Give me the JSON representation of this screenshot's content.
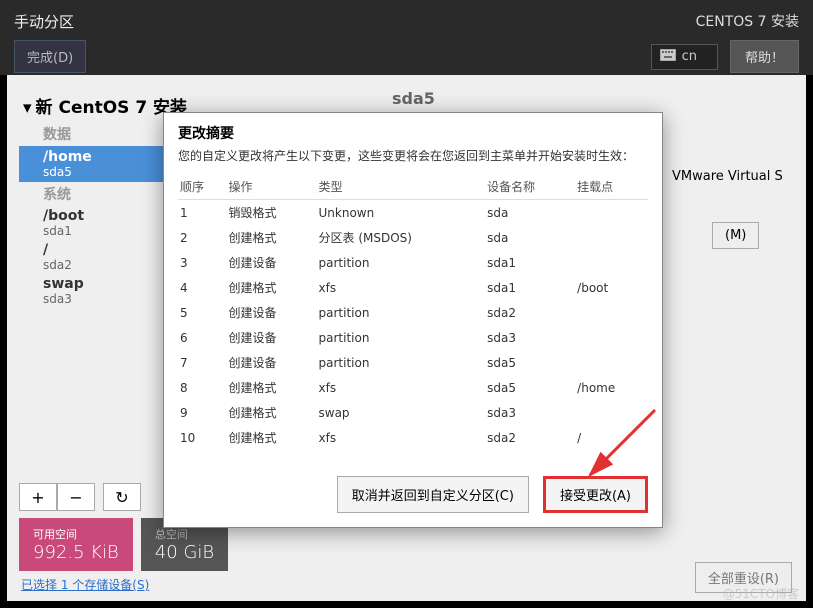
{
  "header": {
    "title": "手动分区",
    "right": "CENTOS 7 安装",
    "done": "完成(D)",
    "keyboard_layout": "cn",
    "help": "帮助！"
  },
  "leftpane": {
    "heading": "新 CentOS 7 安装",
    "sec_data": "数据",
    "sel_mount": "/home",
    "sel_dev": "sda5",
    "sec_sys": "系统",
    "rows": [
      {
        "mp": "/boot",
        "dev": "sda1"
      },
      {
        "mp": "/",
        "dev": "sda2"
      },
      {
        "mp": "swap",
        "dev": "sda3"
      }
    ]
  },
  "rightpane": {
    "title": "sda5",
    "device_text": "VMware Virtual S",
    "modify_btn": "(M)"
  },
  "toolbar": {
    "add": "+",
    "remove": "−",
    "reload": "↻"
  },
  "footer": {
    "avail_label": "可用空间",
    "avail_value": "992.5 KiB",
    "total_label": "总空间",
    "total_value": "40 GiB"
  },
  "storage_link": "已选择 1 个存储设备(S)",
  "reset_all": "全部重设(R)",
  "dialog": {
    "title": "更改摘要",
    "desc": "您的自定义更改将产生以下变更，这些变更将会在您返回到主菜单并开始安装时生效：",
    "columns": {
      "order": "顺序",
      "op": "操作",
      "type": "类型",
      "devname": "设备名称",
      "mount": "挂载点"
    },
    "rows": [
      {
        "n": "1",
        "op": "销毁格式",
        "cls": "op-destroy",
        "type": "Unknown",
        "dev": "sda",
        "mnt": ""
      },
      {
        "n": "2",
        "op": "创建格式",
        "cls": "op-create",
        "type": "分区表 (MSDOS)",
        "dev": "sda",
        "mnt": ""
      },
      {
        "n": "3",
        "op": "创建设备",
        "cls": "op-create",
        "type": "partition",
        "dev": "sda1",
        "mnt": ""
      },
      {
        "n": "4",
        "op": "创建格式",
        "cls": "op-create",
        "type": "xfs",
        "dev": "sda1",
        "mnt": "/boot"
      },
      {
        "n": "5",
        "op": "创建设备",
        "cls": "op-create",
        "type": "partition",
        "dev": "sda2",
        "mnt": ""
      },
      {
        "n": "6",
        "op": "创建设备",
        "cls": "op-create",
        "type": "partition",
        "dev": "sda3",
        "mnt": ""
      },
      {
        "n": "7",
        "op": "创建设备",
        "cls": "op-create",
        "type": "partition",
        "dev": "sda5",
        "mnt": ""
      },
      {
        "n": "8",
        "op": "创建格式",
        "cls": "op-create",
        "type": "xfs",
        "dev": "sda5",
        "mnt": "/home"
      },
      {
        "n": "9",
        "op": "创建格式",
        "cls": "op-create",
        "type": "swap",
        "dev": "sda3",
        "mnt": ""
      },
      {
        "n": "10",
        "op": "创建格式",
        "cls": "op-create",
        "type": "xfs",
        "dev": "sda2",
        "mnt": "/"
      }
    ],
    "cancel": "取消并返回到自定义分区(C)",
    "accept": "接受更改(A)"
  },
  "watermark": "@51CTO博客"
}
